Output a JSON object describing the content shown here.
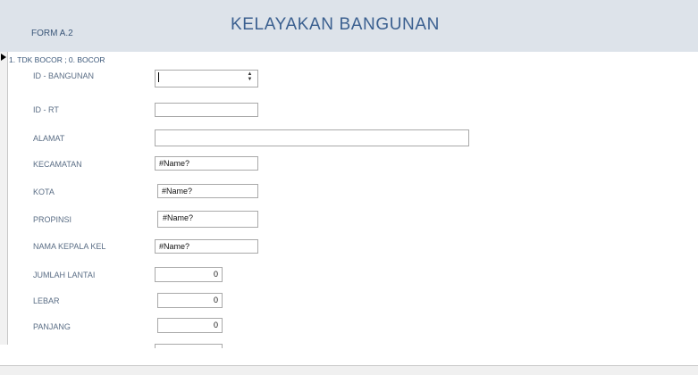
{
  "header": {
    "form_code": "FORM A.2",
    "title": "KELAYAKAN  BANGUNAN"
  },
  "note": "1. TDK BOCOR ; 0. BOCOR",
  "fields": [
    {
      "label": "ID - BANGUNAN",
      "value": ""
    },
    {
      "label": "ID - RT",
      "value": ""
    },
    {
      "label": "ALAMAT",
      "value": ""
    },
    {
      "label": "KECAMATAN",
      "value": "#Name?"
    },
    {
      "label": "KOTA",
      "value": "#Name?"
    },
    {
      "label": "PROPINSI",
      "value": "#Name?"
    },
    {
      "label": "NAMA KEPALA KEL",
      "value": "#Name?"
    },
    {
      "label": "JUMLAH LANTAI",
      "value": "0"
    },
    {
      "label": "LEBAR",
      "value": "0"
    },
    {
      "label": "PANJANG",
      "value": "0"
    }
  ],
  "icons": {
    "record_selector": "triangle-right-icon",
    "spinner": "up-down-arrows-icon"
  }
}
